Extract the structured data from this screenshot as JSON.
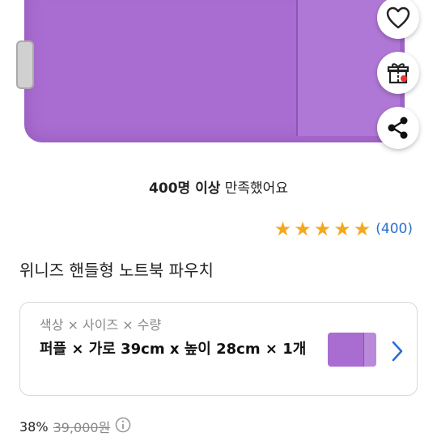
{
  "hero": {
    "image_alt": "purple laptop pouch",
    "color": "#a96cd0"
  },
  "actions": {
    "wishlist_icon": "heart-outline-icon",
    "gift_icon": "gift-icon",
    "share_icon": "share-icon"
  },
  "satisfaction": {
    "bold": "400명 이상",
    "rest": " 만족했어요"
  },
  "rating": {
    "stars": 5,
    "count": "(400)",
    "star_color": "#f4a81d",
    "count_color": "#2a6fd6"
  },
  "product": {
    "title": "위니즈 핸들형 노트북 파우치"
  },
  "option": {
    "label": "색상 × 사이즈 × 수량",
    "value": "퍼플 × 가로 39cm x 높이 28cm × 1개"
  },
  "price": {
    "discount": "38%",
    "original": "39,000원",
    "info_icon": "info-icon"
  }
}
